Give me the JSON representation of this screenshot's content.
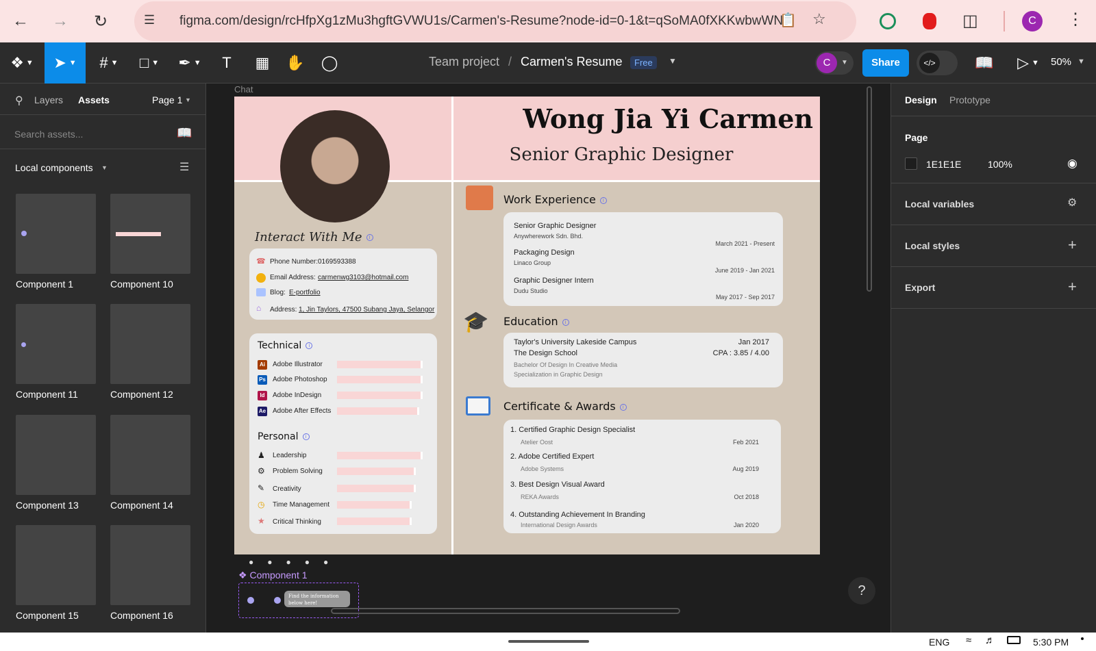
{
  "browser": {
    "url": "figma.com/design/rcHfpXg1zMu3hgftGVWU1s/Carmen's-Resume?node-id=0-1&t=qSoMA0fXKKwbwWN...",
    "profile_initial": "C"
  },
  "toolbar": {
    "breadcrumb_team": "Team project",
    "breadcrumb_sep": "/",
    "file_name": "Carmen's Resume",
    "plan_badge": "Free",
    "avatar_initial": "C",
    "share_label": "Share",
    "zoom": "50%"
  },
  "left": {
    "tab_layers": "Layers",
    "tab_assets": "Assets",
    "page": "Page 1",
    "search_placeholder": "Search assets...",
    "section": "Local components",
    "components": [
      "Component 1",
      "Component 10",
      "Component 11",
      "Component 12",
      "Component 13",
      "Component 14",
      "Component 15",
      "Component 16"
    ]
  },
  "right": {
    "tab_design": "Design",
    "tab_prototype": "Prototype",
    "page_label": "Page",
    "page_color": "1E1E1E",
    "page_opacity": "100%",
    "local_variables": "Local variables",
    "local_styles": "Local styles",
    "export": "Export"
  },
  "canvas": {
    "frame_label": "Chat",
    "component_label": "Component 1",
    "tooltip": "Find the information below here!"
  },
  "resume": {
    "name": "Wong Jia Yi Carmen",
    "title": "Senior Graphic Designer",
    "interact": "Interact With Me",
    "contact": [
      {
        "label": "Phone Number:",
        "value": "0169593388"
      },
      {
        "label": "Email Address:",
        "value": "carmenwg3103@hotmail.com"
      },
      {
        "label": "Blog:",
        "value": "E-portfolio"
      },
      {
        "label": "Address:",
        "value": "1, Jin Taylors, 47500 Subang Jaya, Selangor"
      }
    ],
    "technical_title": "Technical",
    "technical": [
      {
        "name": "Adobe Illustrator",
        "icon": "Ai",
        "level": 0.98
      },
      {
        "name": "Adobe Photoshop",
        "icon": "Ps",
        "level": 0.98
      },
      {
        "name": "Adobe InDesign",
        "icon": "Id",
        "level": 0.98
      },
      {
        "name": "Adobe After Effects",
        "icon": "Ae",
        "level": 0.94
      }
    ],
    "personal_title": "Personal",
    "personal": [
      {
        "name": "Leadership",
        "level": 0.98
      },
      {
        "name": "Problem Solving",
        "level": 0.9
      },
      {
        "name": "Creativity",
        "level": 0.9
      },
      {
        "name": "Time Management",
        "level": 0.85
      },
      {
        "name": "Critical Thinking",
        "level": 0.85
      }
    ],
    "work_title": "Work Experience",
    "work": [
      {
        "role": "Senior Graphic Designer",
        "company": "Anywherework Sdn. Bhd.",
        "period": "March 2021 - Present"
      },
      {
        "role": "Packaging Design",
        "company": "Linaco Group",
        "period": "June 2019 - Jan 2021"
      },
      {
        "role": "Graphic Designer Intern",
        "company": "Dudu Studio",
        "period": "May 2017 - Sep 2017"
      }
    ],
    "edu_title": "Education",
    "edu": {
      "school": "Taylor's University Lakeside Campus",
      "faculty": "The Design School",
      "date": "Jan 2017",
      "cpa": "CPA : 3.85 / 4.00",
      "degree": "Bachelor Of Design In Creative Media",
      "spec": "Specialization in Graphic Design"
    },
    "cert_title": "Certificate & Awards",
    "certs": [
      {
        "name": "1. Certified Graphic Design Specialist",
        "org": "Atelier Oost",
        "date": "Feb 2021"
      },
      {
        "name": "2. Adobe Certified Expert",
        "org": "Adobe Systems",
        "date": "Aug 2019"
      },
      {
        "name": "3. Best Design Visual Award",
        "org": "REKA Awards",
        "date": "Oct 2018"
      },
      {
        "name": "4. Outstanding Achievement In Branding",
        "org": "International Design Awards",
        "date": "Jan 2020"
      }
    ]
  },
  "status": {
    "lang": "ENG",
    "time": "5:30 PM"
  }
}
